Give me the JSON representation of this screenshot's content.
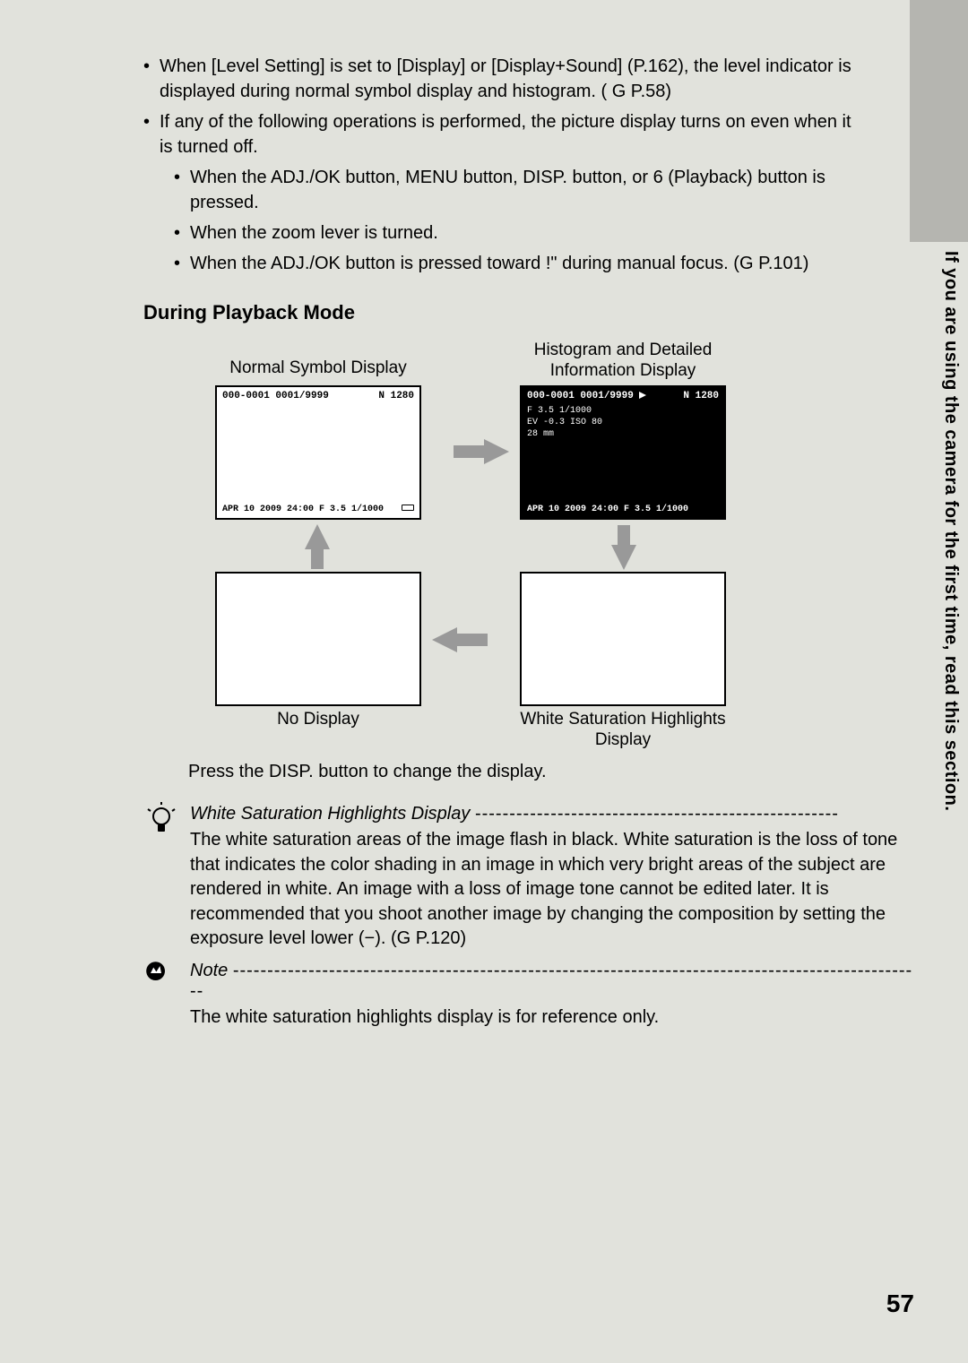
{
  "bullets": {
    "b1": "When [Level Setting] is set to [Display] or [Display+Sound] (P.162), the level indicator is displayed during normal symbol display and histogram. ( G P.58)",
    "b2": "If any of the following operations is performed, the picture display turns on even when it is turned off.",
    "b2_sub": {
      "s1": "When the ADJ./OK button, MENU button, DISP. button, or 6 (Playback) button is pressed.",
      "s2": "When the zoom lever is turned.",
      "s3": "When the ADJ./OK button is pressed toward !\" during manual focus. (G P.101)"
    }
  },
  "heading": "During Playback Mode",
  "diagram": {
    "normal_label": "Normal Symbol Display",
    "hist_label": "Histogram and Detailed Information Display",
    "no_display_label": "No Display",
    "white_sat_label": "White Saturation Highlights Display",
    "press_line": "Press the DISP. button to change the display.",
    "screen_header_left": "000-0001 0001/9999",
    "screen_header_right": "N 1280",
    "screen_info_l1": "F 3.5  1/1000",
    "screen_info_l2": "EV -0.3  ISO 80",
    "screen_info_l3": "28 mm",
    "screen_footer": "APR 10 2009 24:00 F 3.5 1/1000"
  },
  "tip": {
    "title": "White Saturation Highlights Display",
    "body": "The white saturation areas of the image flash in black. White saturation is the loss of tone that indicates the color shading in an image in which very bright areas of the subject are rendered in white. An image with a loss of image tone cannot be edited later. It is recommended that you shoot another image by changing the composition by setting the exposure level lower (−). (G P.120)"
  },
  "note": {
    "title": "Note",
    "body": "The white saturation highlights display is for reference only."
  },
  "vertical": "If you are using the camera for the first time, read this section.",
  "page_number": "57"
}
